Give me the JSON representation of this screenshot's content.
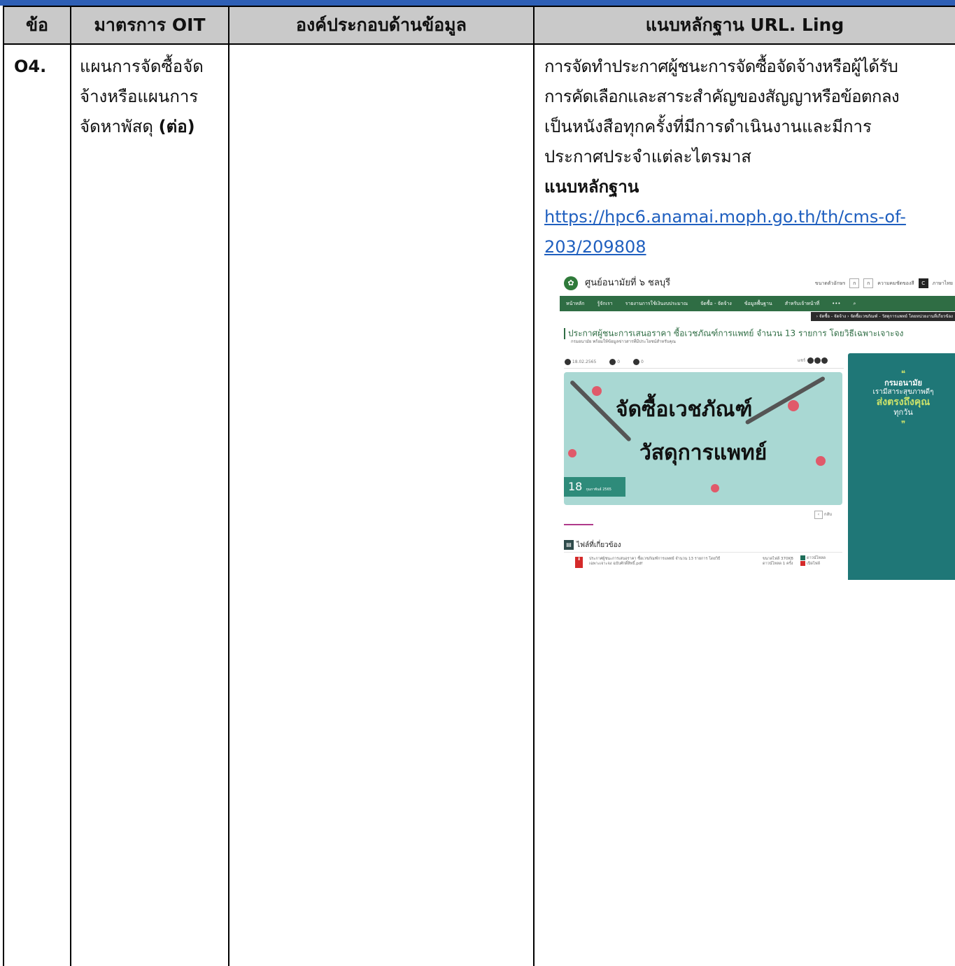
{
  "table": {
    "headers": [
      "ข้อ",
      "มาตรการ OIT",
      "องค์ประกอบด้านข้อมูล",
      "แนบหลักฐาน URL. Ling"
    ],
    "row": {
      "no": "O4.",
      "measure_lines": [
        "แผนการจัดซื้อจัด",
        "จ้างหรือแผนการ",
        "จัดหาพัสดุ"
      ],
      "measure_bold": "(ต่อ)",
      "component": "",
      "evidence_lines": [
        "การจัดทำประกาศผู้ชนะการจัดซื้อจัดจ้างหรือผู้ได้รับ",
        "การคัดเลือกและสาระสำคัญของสัญญาหรือข้อตกลง",
        "เป็นหนังสือทุกครั้งที่มีการดำเนินงานและมีการ",
        "ประกาศประจำแต่ละไตรมาส"
      ],
      "evidence_heading": "แนบหลักฐาน",
      "evidence_url_lines": [
        "https://hpc6.anamai.moph.go.th/th/cms-of-",
        "203/209808"
      ]
    }
  },
  "screenshot": {
    "site_name": "ศูนย์อนามัยที่ ๖ ชลบุรี",
    "header_right": {
      "font_size": "ขนาดตัวอักษร",
      "contrast": "ความคมชัดของสี",
      "language": "ภาษาไทย"
    },
    "nav_items": [
      "หน้าหลัก",
      "รู้จักเรา",
      "รายงานการใช้เงินงบประมาณ",
      "จัดซื้อ - จัดจ้าง",
      "ข้อมูลพื้นฐาน",
      "สำหรับเจ้าหน้าที่",
      "•••"
    ],
    "breadcrumb": "› จัดซื้อ - จัดจ้าง › จัดซื้อเวชภัณฑ์ - วัสดุการแพทย์ โดยหน่วยงานที่เกี่ยวข้อง",
    "title": "ประกาศผู้ชนะการเสนอราคา ซื้อเวชภัณฑ์การแพทย์ จำนวน 13 รายการ โดยวิธีเฉพาะเจาะจง",
    "subtitle": "กรมอนามัย พร้อมให้ข้อมูลข่าวสารที่มีประโยชน์สำหรับคุณ",
    "meta_date": "18.02.2565",
    "meta_views": "0",
    "meta_downloads": "0",
    "share_label": "แชร์",
    "banner_line1": "จัดซื้อเวชภัณฑ์",
    "banner_line2": "วัสดุการแพทย์",
    "banner_day": "18",
    "banner_month": "กุมภาพันธ์ 2565",
    "side": {
      "quote_open": "❝",
      "line1": "กรมอนามัย",
      "line2": "เรามีสาระสุขภาพดีๆ",
      "line3": "ส่งตรงถึงคุณ",
      "line4": "ทุกวัน",
      "quote_close": "❞"
    },
    "back_label": "กลับ",
    "files_title": "ไฟล์ที่เกี่ยวข้อง",
    "file_name": "ประกาศผู้ชนะการเสนอราคา ซื้อเวชภัณฑ์การแพทย์ จำนวน 13 รายการ โดยวิธีเฉพาะเจาะจง ฉบับศักดิ์สิทธิ์.pdf",
    "file_size": "ขนาดไฟล์ 370KB",
    "file_downloads": "ดาวน์โหลด 1 ครั้ง",
    "download_label": "ดาวน์โหลด",
    "preview_label": "เปิดไฟล์",
    "colors": {
      "header_line": "#2e5fb5",
      "header_bg": "#c9c9c9",
      "link": "#1f5fbf",
      "nav": "#2f6d44",
      "side": "#1f7777"
    }
  }
}
